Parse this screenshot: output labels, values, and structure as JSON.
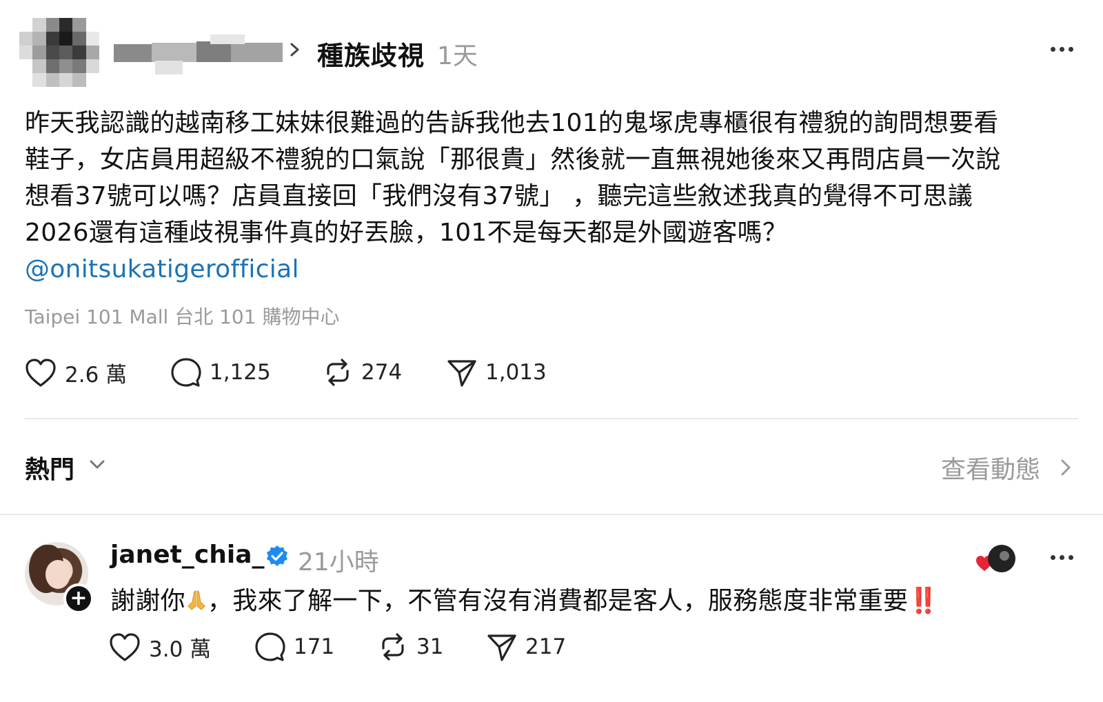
{
  "post": {
    "topic": "種族歧視",
    "time": "1天",
    "body_lines": [
      "昨天我認識的越南移工妹妹很難過的告訴我他去101的鬼塚虎專櫃很有禮貌的詢問想要看",
      "鞋子，女店員用超級不禮貌的口氣說「那很貴」然後就一直無視她後來又再問店員一次說",
      "想看37號可以嗎？店員直接回「我們沒有37號」 ，聽完這些敘述我真的覺得不可思議",
      "2026還有這種歧視事件真的好丟臉，101不是每天都是外國遊客嗎？"
    ],
    "mention": "@onitsukatigerofficial",
    "location": "Taipei 101 Mall 台北 101 購物中心",
    "stats": {
      "likes": "2.6 萬",
      "comments": "1,125",
      "reposts": "274",
      "shares": "1,013"
    }
  },
  "sort": {
    "label": "熱門",
    "activity_label": "查看動態"
  },
  "reply": {
    "username": "janet_chia_",
    "time": "21小時",
    "text_before_emoji": "謝謝你",
    "text_after_emoji": "，我來了解一下，不管有沒有消費都是客人，服務態度非常重要",
    "emphasis": "‼️",
    "stats": {
      "likes": "3.0 萬",
      "comments": "171",
      "reposts": "31",
      "shares": "217"
    }
  },
  "icons": [
    "chevron-right-icon",
    "more-icon",
    "heart-icon",
    "comment-icon",
    "repost-icon",
    "share-icon",
    "chevron-down-icon",
    "verified-icon",
    "folded-hands-icon",
    "plus-icon"
  ],
  "colors": {
    "mention": "#1a73b8",
    "muted": "#9a9a9a",
    "verified": "#1d8cf0",
    "emphasis": "#e0202a"
  }
}
